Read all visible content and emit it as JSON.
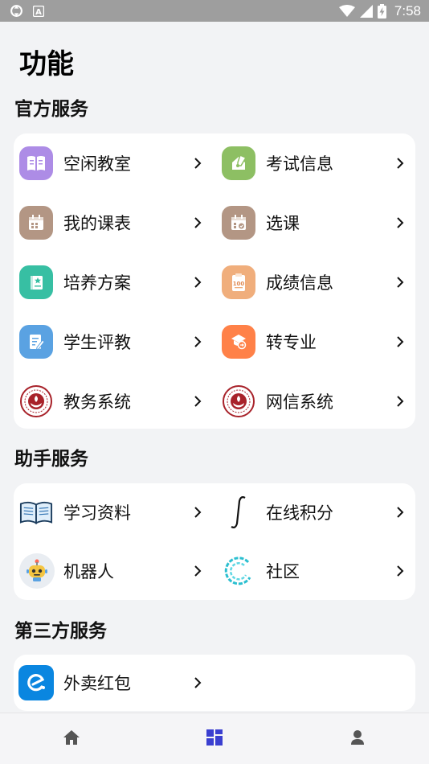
{
  "status_bar": {
    "time": "7:58",
    "icons": [
      "sync-icon",
      "a-notification-icon",
      "wifi-icon",
      "cellular-signal-icon",
      "battery-charging-icon"
    ]
  },
  "page": {
    "title": "功能"
  },
  "sections": [
    {
      "title": "官方服务",
      "items": [
        {
          "label": "空闲教室",
          "icon": "book-icon",
          "color": "#ad8ce6"
        },
        {
          "label": "考试信息",
          "icon": "exam-pen-icon",
          "color": "#8dbf63"
        },
        {
          "label": "我的课表",
          "icon": "calendar-icon",
          "color": "#b39684"
        },
        {
          "label": "选课",
          "icon": "calendar-select-icon",
          "color": "#b39684"
        },
        {
          "label": "培养方案",
          "icon": "plan-book-icon",
          "color": "#37bfa3"
        },
        {
          "label": "成绩信息",
          "icon": "score-clipboard-icon",
          "color": "#f0ae7c"
        },
        {
          "label": "学生评教",
          "icon": "evaluation-icon",
          "color": "#5aa2e2"
        },
        {
          "label": "转专业",
          "icon": "transfer-icon",
          "color": "#ff8148"
        },
        {
          "label": "教务系统",
          "icon": "university-seal-icon",
          "color": "#a8222a"
        },
        {
          "label": "网信系统",
          "icon": "university-seal-icon",
          "color": "#a8222a"
        }
      ]
    },
    {
      "title": "助手服务",
      "items": [
        {
          "label": "学习资料",
          "icon": "open-book-icon",
          "color": "#2a6fb0"
        },
        {
          "label": "在线积分",
          "icon": "integral-icon",
          "color": "#111111"
        },
        {
          "label": "机器人",
          "icon": "robot-icon",
          "color": "#f4c542"
        },
        {
          "label": "社区",
          "icon": "community-ring-icon",
          "color": "#2bbfd0"
        }
      ]
    },
    {
      "title": "第三方服务",
      "items": [
        {
          "label": "外卖红包",
          "icon": "eleme-icon",
          "color": "#0a86e0"
        }
      ]
    }
  ],
  "bottom_nav": {
    "items": [
      {
        "name": "home",
        "icon": "home-icon",
        "active": false
      },
      {
        "name": "functions",
        "icon": "grid-icon",
        "active": true
      },
      {
        "name": "profile",
        "icon": "user-icon",
        "active": false
      }
    ],
    "active_color": "#3a3fd0",
    "inactive_color": "#555555"
  }
}
